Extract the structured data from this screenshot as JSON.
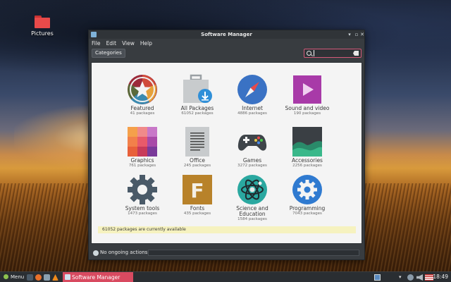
{
  "desktop": {
    "icons": [
      {
        "label": "Pictures",
        "icon": "folder-icon",
        "color": "#e84a4a"
      }
    ]
  },
  "window": {
    "title": "Software Manager",
    "menu": [
      "File",
      "Edit",
      "View",
      "Help"
    ],
    "toolbar": {
      "categories_label": "Categories",
      "search_value": "",
      "search_icon": "search-icon",
      "clear_icon": "backspace-icon"
    },
    "categories": [
      {
        "name": "Featured",
        "count": "41 packages",
        "icon": "star-icon"
      },
      {
        "name": "All Packages",
        "count": "61052 packages",
        "icon": "package-icon"
      },
      {
        "name": "Internet",
        "count": "4886 packages",
        "icon": "compass-icon"
      },
      {
        "name": "Sound and video",
        "count": "190 packages",
        "icon": "video-icon"
      },
      {
        "name": "Graphics",
        "count": "761 packages",
        "icon": "palette-icon"
      },
      {
        "name": "Office",
        "count": "245 packages",
        "icon": "document-icon"
      },
      {
        "name": "Games",
        "count": "3272 packages",
        "icon": "gamepad-icon"
      },
      {
        "name": "Accessories",
        "count": "2256 packages",
        "icon": "chart-icon"
      },
      {
        "name": "System tools",
        "count": "1473 packages",
        "icon": "gear-icon"
      },
      {
        "name": "Fonts",
        "count": "435 packages",
        "icon": "font-icon"
      },
      {
        "name": "Science and Education",
        "count": "1584 packages",
        "icon": "atom-icon"
      },
      {
        "name": "Programming",
        "count": "7043 packages",
        "icon": "cog-icon"
      }
    ],
    "status_message": "61052 packages are currently available",
    "bottom_status": "No ongoing actions"
  },
  "taskbar": {
    "menu_label": "Menu",
    "task_label": "Software Manager",
    "clock": "18:49"
  }
}
